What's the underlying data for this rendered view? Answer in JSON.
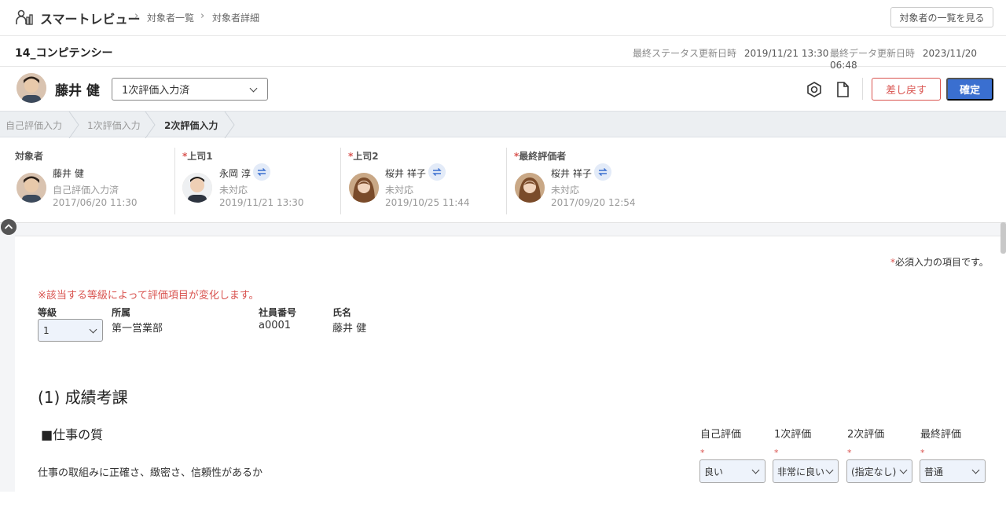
{
  "header": {
    "app_name": "スマートレビュー",
    "breadcrumbs": [
      "対象者一覧",
      "対象者詳細"
    ],
    "list_button": "対象者の一覧を見る"
  },
  "sheet": {
    "title": "14_コンピテンシー",
    "status_updated_label": "最終ステータス更新日時",
    "status_updated_value": "2019/11/21 13:30",
    "data_updated_label": "最終データ更新日時",
    "data_updated_value": "2023/11/20 06:48"
  },
  "person": {
    "name": "藤井 健",
    "status_selected": "1次評価入力済",
    "return_button": "差し戻す",
    "confirm_button": "確定"
  },
  "steps": [
    {
      "label": "自己評価入力",
      "active": false
    },
    {
      "label": "1次評価入力",
      "active": false
    },
    {
      "label": "2次評価入力",
      "active": true
    }
  ],
  "evaluators": [
    {
      "role": "対象者",
      "required": false,
      "name": "藤井 健",
      "status": "自己評価入力済",
      "time": "2017/06/20 11:30"
    },
    {
      "role": "上司1",
      "required": true,
      "name": "永岡 淳",
      "status": "未対応",
      "time": "2019/11/21 13:30"
    },
    {
      "role": "上司2",
      "required": true,
      "name": "桜井 祥子",
      "status": "未対応",
      "time": "2019/10/25 11:44"
    },
    {
      "role": "最終評価者",
      "required": true,
      "name": "桜井 祥子",
      "status": "未対応",
      "time": "2017/09/20 12:54"
    }
  ],
  "form": {
    "required_note": "必須入力の項目です。",
    "warning": "※該当する等級によって評価項目が変化します。",
    "grade_label": "等級",
    "grade_value": "1",
    "dept_label": "所属",
    "dept_value": "第一営業部",
    "empno_label": "社員番号",
    "empno_value": "a0001",
    "name_label": "氏名",
    "name_value": "藤井 健"
  },
  "section": {
    "title": "(1) 成績考課",
    "subsection": "■仕事の質",
    "columns": [
      "自己評価",
      "1次評価",
      "2次評価",
      "最終評価"
    ],
    "item": "仕事の取組みに正確さ、緻密さ、信頼性があるか",
    "ratings": [
      "良い",
      "非常に良い",
      "(指定なし)",
      "普通"
    ]
  },
  "colors": {
    "accent": "#3a6fd0",
    "danger": "#d9534f"
  }
}
